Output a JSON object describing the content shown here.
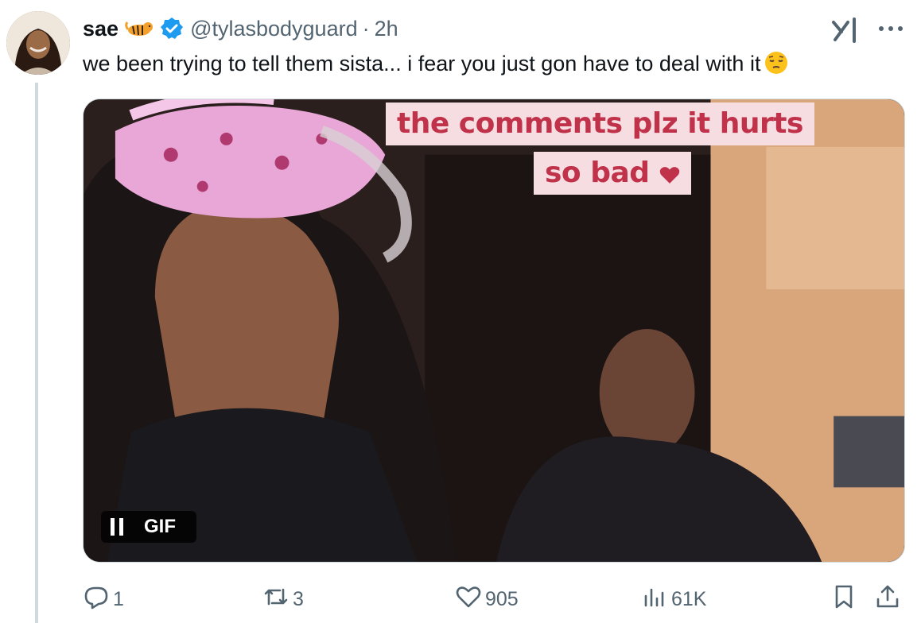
{
  "author": {
    "name": "sae",
    "handle": "@tylasbodyguard",
    "separator": "·",
    "time": "2h",
    "badges": [
      "tiger-emoji",
      "verified-icon"
    ]
  },
  "tweet": {
    "text": "we been trying to tell them sista... i fear you just gon have to deal with it",
    "trailing_emoji": "pensive-face-emoji"
  },
  "media": {
    "caption_line1": "the comments plz it hurts",
    "caption_line2": "so bad",
    "caption_emoji": "heart-icon",
    "gif_label": "GIF",
    "caption_color": "#c0324a",
    "caption_bg": "#f6dde2"
  },
  "actions": {
    "replies": "1",
    "reposts": "3",
    "likes": "905",
    "views": "61K"
  },
  "colors": {
    "verified": "#1d9bf0",
    "muted": "#536471",
    "thread_line": "#cfd9de"
  }
}
